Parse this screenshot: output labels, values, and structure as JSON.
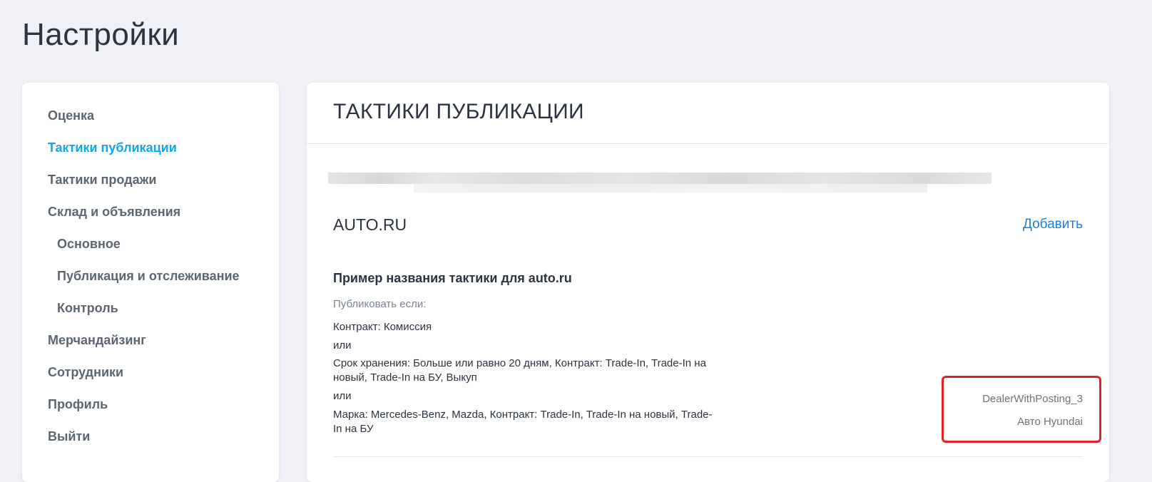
{
  "page_title": "Настройки",
  "sidebar": {
    "items": [
      {
        "label": "Оценка"
      },
      {
        "label": "Тактики публикации"
      },
      {
        "label": "Тактики продажи"
      },
      {
        "label": "Склад и объявления"
      },
      {
        "label": "Основное"
      },
      {
        "label": "Публикация и отслеживание"
      },
      {
        "label": "Контроль"
      },
      {
        "label": "Мерчандайзинг"
      },
      {
        "label": "Сотрудники"
      },
      {
        "label": "Профиль"
      },
      {
        "label": "Выйти"
      }
    ],
    "active_color": "#10a8e8"
  },
  "main": {
    "title": "ТАКТИКИ ПУБЛИКАЦИИ",
    "section": {
      "name": "AUTO.RU",
      "add_label": "Добавить"
    },
    "tactic": {
      "name": "Пример названия тактики для auto.ru",
      "publish_if_label": "Публиковать если:",
      "conditions": [
        "Контракт: Комиссия",
        "или",
        "Срок хранения: Больше или равно 20 дням, Контракт: Trade-In, Trade-In на новый, Trade-In на БУ, Выкуп",
        "или",
        "Марка: Mercedes-Benz, Mazda, Контракт: Trade-In, Trade-In на новый, Trade-In на БУ"
      ],
      "dealer": "DealerWithPosting_3",
      "company": "Авто Hyundai"
    }
  },
  "colors": {
    "background": "#eff1f6",
    "link": "#1f7fd1",
    "highlight": "#e0222b"
  }
}
